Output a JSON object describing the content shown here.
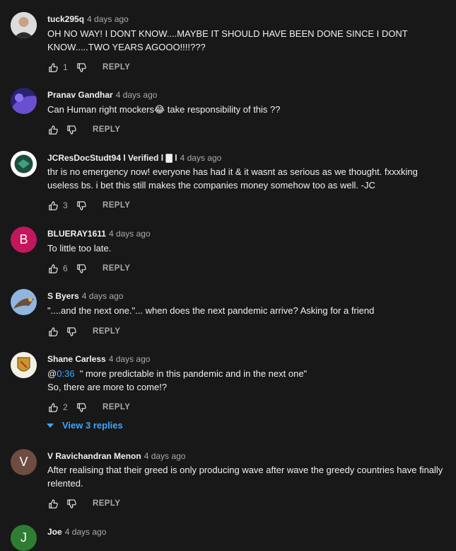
{
  "comments": [
    {
      "author": "tuck295q",
      "time": "4 days ago",
      "text": "OH NO WAY! I DONT KNOW....MAYBE IT SHOULD HAVE BEEN DONE SINCE I DONT KNOW.....TWO YEARS AGOOO!!!!???",
      "likes": "1",
      "reply_label": "REPLY",
      "avatar_color": "#9fa3a6"
    },
    {
      "author": "Pranav Gandhar",
      "time": "4 days ago",
      "text": "Can Human right mockers😂  take responsibility of this ??",
      "likes": "",
      "reply_label": "REPLY",
      "avatar_color": "#4a3fa3"
    },
    {
      "author": "JCResDocStudt94 l Verified l 🀫 l",
      "time": "4 days ago",
      "text": "thr is no emergency now! everyone has had it & it wasnt as serious as we thought. fxxxking useless bs. i bet this still makes the companies money somehow too as well. -JC",
      "likes": "3",
      "reply_label": "REPLY",
      "avatar_color": "#1f6f56"
    },
    {
      "author": "BLUERAY1611",
      "time": "4 days ago",
      "text": "To little too late.",
      "likes": "6",
      "reply_label": "REPLY",
      "avatar_letter": "B",
      "avatar_color": "#c2185b"
    },
    {
      "author": "S Byers",
      "time": "4 days ago",
      "text": "\"....and the next one.\"...  when does the next pandemic arrive?  Asking for a friend",
      "likes": "",
      "reply_label": "REPLY",
      "avatar_color": "#5f86b8"
    },
    {
      "author": "Shane Carless",
      "time": "4 days ago",
      "text_prefix": "@",
      "timestamp_link": "0:36",
      "text_after": "  \" more predictable in this pandemic and in the next one\"",
      "text_line2": "So, there are more to come!?",
      "likes": "2",
      "reply_label": "REPLY",
      "avatar_color": "#f4f0e6"
    },
    {
      "author": "V Ravichandran Menon",
      "time": "4 days ago",
      "text": "After  realising that their greed is only producing wave after wave the greedy countries  have finally  relented.",
      "likes": "",
      "reply_label": "REPLY",
      "avatar_letter": "V",
      "avatar_color": "#6d4c41"
    },
    {
      "author": "Joe",
      "time": "4 days ago",
      "avatar_letter": "J",
      "avatar_color": "#2e7d32"
    }
  ],
  "view_replies": "View 3 replies",
  "colors": {
    "background": "#181818",
    "link": "#3ea6ff",
    "secondary": "#aaaaaa"
  }
}
